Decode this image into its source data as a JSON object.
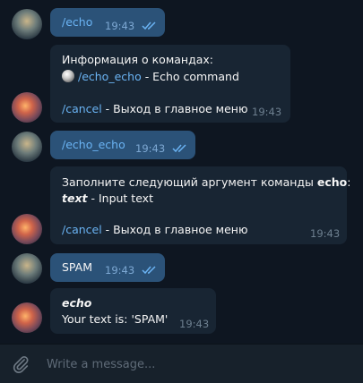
{
  "messages": [
    {
      "from": "user",
      "text": "/echo",
      "time": "19:43"
    },
    {
      "from": "bot",
      "header": "Информация о командах:",
      "cmd_link": "/echo_echo",
      "cmd_desc": " - Echo command",
      "cancel_link": "/cancel",
      "cancel_desc": " - Выход в главное меню",
      "time": "19:43"
    },
    {
      "from": "user",
      "text": "/echo_echo",
      "time": "19:43"
    },
    {
      "from": "bot",
      "line1_prefix": "Заполните следующий аргумент  команды ",
      "line1_bold": "echo",
      "line1_suffix": ":",
      "arg_name": "text",
      "arg_desc": " - Input text",
      "cancel_link": "/cancel",
      "cancel_desc": " - Выход в главное меню",
      "time": "19:43"
    },
    {
      "from": "user",
      "text": "SPAM",
      "time": "19:43"
    },
    {
      "from": "bot",
      "title": "echo",
      "body": "Your text is: 'SPAM'",
      "time": "19:43"
    }
  ],
  "composer": {
    "placeholder": "Write a message..."
  },
  "colors": {
    "background": "#0e1621",
    "outgoing": "#2b5278",
    "incoming": "#182533",
    "link": "#6ab3f3"
  }
}
